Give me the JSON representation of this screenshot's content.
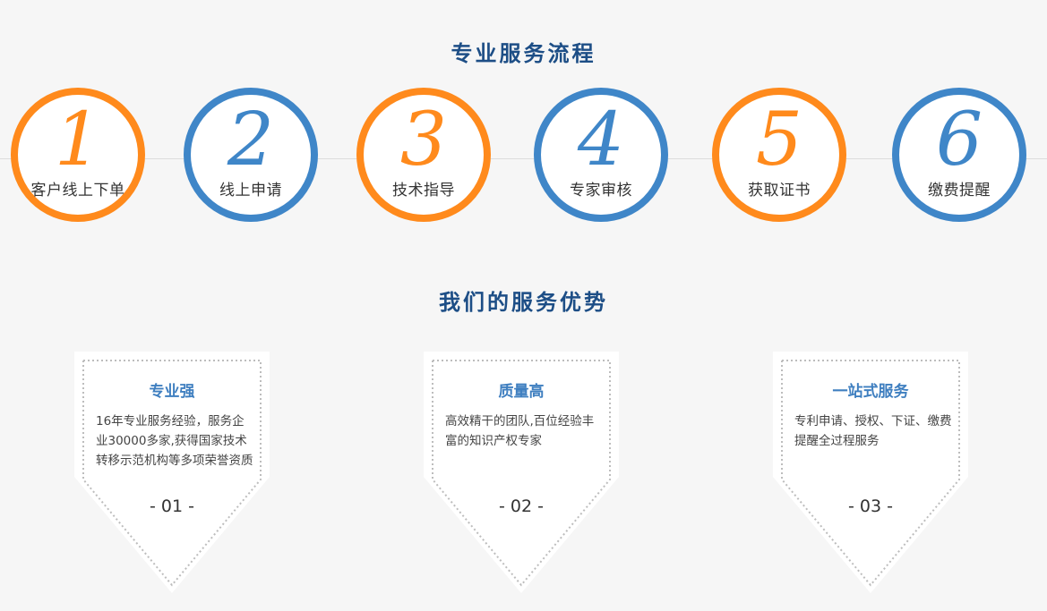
{
  "process": {
    "title": "专业服务流程",
    "steps": [
      {
        "num": "1",
        "label": "客户线上下单",
        "color": "orange"
      },
      {
        "num": "2",
        "label": "线上申请",
        "color": "blue"
      },
      {
        "num": "3",
        "label": "技术指导",
        "color": "orange"
      },
      {
        "num": "4",
        "label": "专家审核",
        "color": "blue"
      },
      {
        "num": "5",
        "label": "获取证书",
        "color": "orange"
      },
      {
        "num": "6",
        "label": "缴费提醒",
        "color": "blue"
      }
    ]
  },
  "advantages": {
    "title": "我们的服务优势",
    "cards": [
      {
        "title": "专业强",
        "desc": "16年专业服务经验，服务企业30000多家,获得国家技术转移示范机构等多项荣誉资质",
        "num": "- 01 -"
      },
      {
        "title": "质量高",
        "desc": "高效精干的团队,百位经验丰富的知识产权专家",
        "num": "- 02 -"
      },
      {
        "title": "一站式服务",
        "desc": "专利申请、授权、下证、缴费提醒全过程服务",
        "num": "- 03 -"
      }
    ]
  },
  "colors": {
    "orange": "#ff8a1c",
    "blue": "#3f86c8",
    "title": "#1d4e86",
    "card_title": "#3f7fc0"
  }
}
